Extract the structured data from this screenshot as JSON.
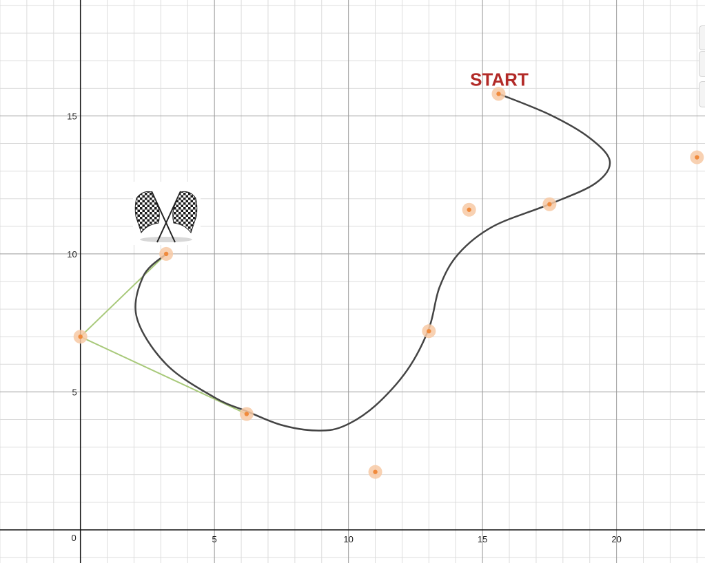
{
  "chart_data": {
    "type": "scatter",
    "title": "",
    "xlabel": "",
    "ylabel": "",
    "xlim": [
      -3,
      23.3
    ],
    "ylim": [
      -1.2,
      19.2
    ],
    "grid": true,
    "major_step": 5,
    "minor_step": 1,
    "x_ticks": [
      0,
      5,
      10,
      15,
      20
    ],
    "y_ticks": [
      5,
      10,
      15
    ],
    "origin_label": "0",
    "annotation": {
      "text": "START",
      "x": 15.6,
      "y": 16.2,
      "color": "#b22a27"
    },
    "finish_flag_icon": "checkered-flags-icon",
    "curve": {
      "color": "#444444",
      "points": [
        [
          15.6,
          15.8
        ],
        [
          17.5,
          15.05
        ],
        [
          19.0,
          14.2
        ],
        [
          19.75,
          13.35
        ],
        [
          19.2,
          12.55
        ],
        [
          17.5,
          11.8
        ],
        [
          15.4,
          11.0
        ],
        [
          14.1,
          10.0
        ],
        [
          13.4,
          8.8
        ],
        [
          13.0,
          7.3
        ],
        [
          12.2,
          5.8
        ],
        [
          11.0,
          4.5
        ],
        [
          9.8,
          3.75
        ],
        [
          8.8,
          3.6
        ],
        [
          7.5,
          3.8
        ],
        [
          6.2,
          4.3
        ],
        [
          5.0,
          4.8
        ],
        [
          3.2,
          6.0
        ],
        [
          2.1,
          7.7
        ],
        [
          2.35,
          9.2
        ],
        [
          3.2,
          10.0
        ]
      ]
    },
    "points": {
      "color": "#f08a3c",
      "halo_color": "#f7c9a4",
      "values": [
        [
          15.6,
          15.8
        ],
        [
          23.0,
          13.5
        ],
        [
          17.5,
          11.8
        ],
        [
          14.5,
          11.6
        ],
        [
          3.2,
          10.0
        ],
        [
          13.0,
          7.2
        ],
        [
          0.0,
          7.0
        ],
        [
          6.2,
          4.2
        ],
        [
          11.0,
          2.1
        ]
      ]
    },
    "segments": {
      "color": "#a8c97a",
      "values": [
        [
          [
            0.0,
            7.0
          ],
          [
            3.2,
            10.0
          ]
        ],
        [
          [
            0.0,
            7.0
          ],
          [
            6.2,
            4.2
          ]
        ]
      ]
    }
  }
}
